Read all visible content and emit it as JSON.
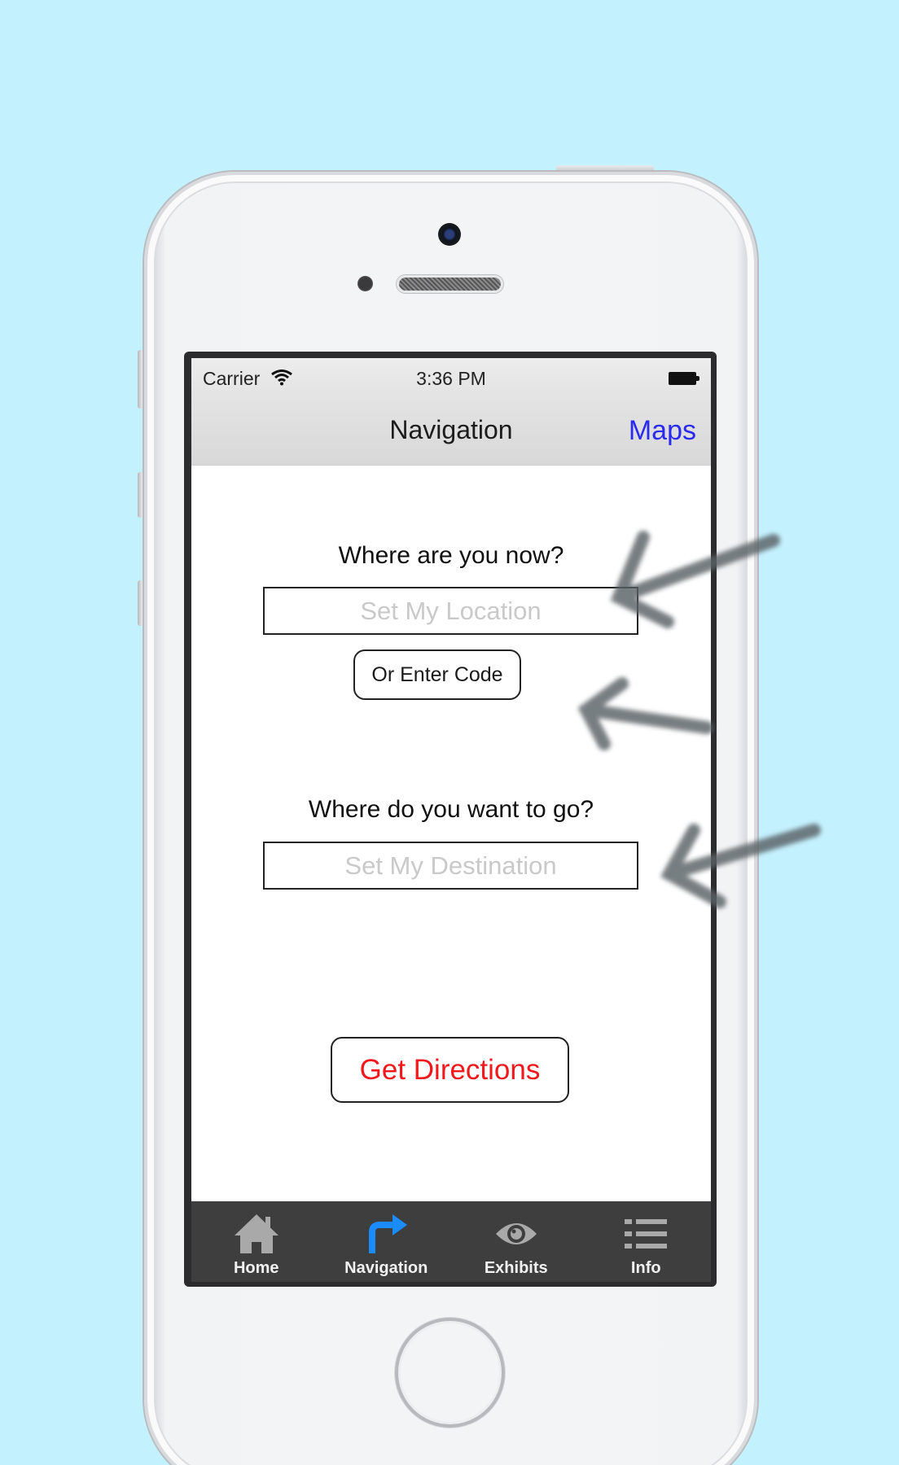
{
  "colors": {
    "background": "#c4f1fe",
    "accent_blue": "#2b2bf0",
    "selected_tab": "#1a8cff",
    "directions_red": "#f2181c",
    "tab_bar": "#3e3e3e"
  },
  "status_bar": {
    "carrier": "Carrier",
    "time": "3:36 PM",
    "wifi_icon": "wifi-icon",
    "battery_icon": "battery-full-icon"
  },
  "nav_bar": {
    "title": "Navigation",
    "right_button": "Maps"
  },
  "form": {
    "origin_question": "Where are you now?",
    "origin_placeholder": "Set My Location",
    "origin_value": "",
    "code_button": "Or Enter Code",
    "destination_question": "Where do you want to go?",
    "destination_placeholder": "Set My Destination",
    "destination_value": "",
    "submit_button": "Get Directions"
  },
  "tab_bar": {
    "selected": "Navigation",
    "tabs": [
      {
        "label": "Home",
        "icon": "home-icon"
      },
      {
        "label": "Navigation",
        "icon": "turn-right-arrow-icon"
      },
      {
        "label": "Exhibits",
        "icon": "eye-icon"
      },
      {
        "label": "Info",
        "icon": "list-icon"
      }
    ]
  }
}
